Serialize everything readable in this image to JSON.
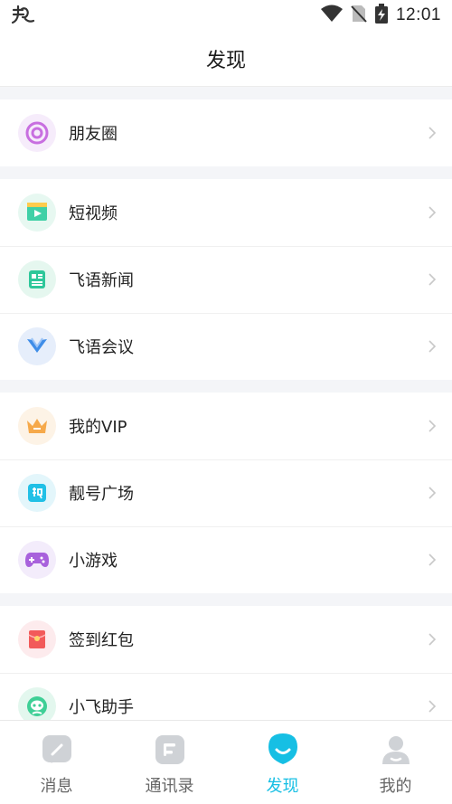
{
  "status_bar": {
    "time": "12:01"
  },
  "header": {
    "title": "发现"
  },
  "groups": [
    {
      "items": [
        {
          "label": "朋友圈",
          "icon": "moments-icon"
        }
      ]
    },
    {
      "items": [
        {
          "label": "短视频",
          "icon": "video-icon"
        },
        {
          "label": "飞语新闻",
          "icon": "news-icon"
        },
        {
          "label": "飞语会议",
          "icon": "meeting-icon"
        }
      ]
    },
    {
      "items": [
        {
          "label": "我的VIP",
          "icon": "crown-icon"
        },
        {
          "label": "靓号广场",
          "icon": "liang-icon"
        },
        {
          "label": "小游戏",
          "icon": "gamepad-icon"
        }
      ]
    },
    {
      "items": [
        {
          "label": "签到红包",
          "icon": "red-envelope-icon"
        },
        {
          "label": "小飞助手",
          "icon": "assistant-icon"
        }
      ]
    }
  ],
  "tabbar": {
    "items": [
      {
        "label": "消息",
        "icon": "message-icon"
      },
      {
        "label": "通讯录",
        "icon": "contacts-icon"
      },
      {
        "label": "发现",
        "icon": "discover-icon",
        "active": true
      },
      {
        "label": "我的",
        "icon": "profile-icon"
      }
    ]
  },
  "colors": {
    "accent": "#16bfe4",
    "background": "#f4f5f8"
  }
}
